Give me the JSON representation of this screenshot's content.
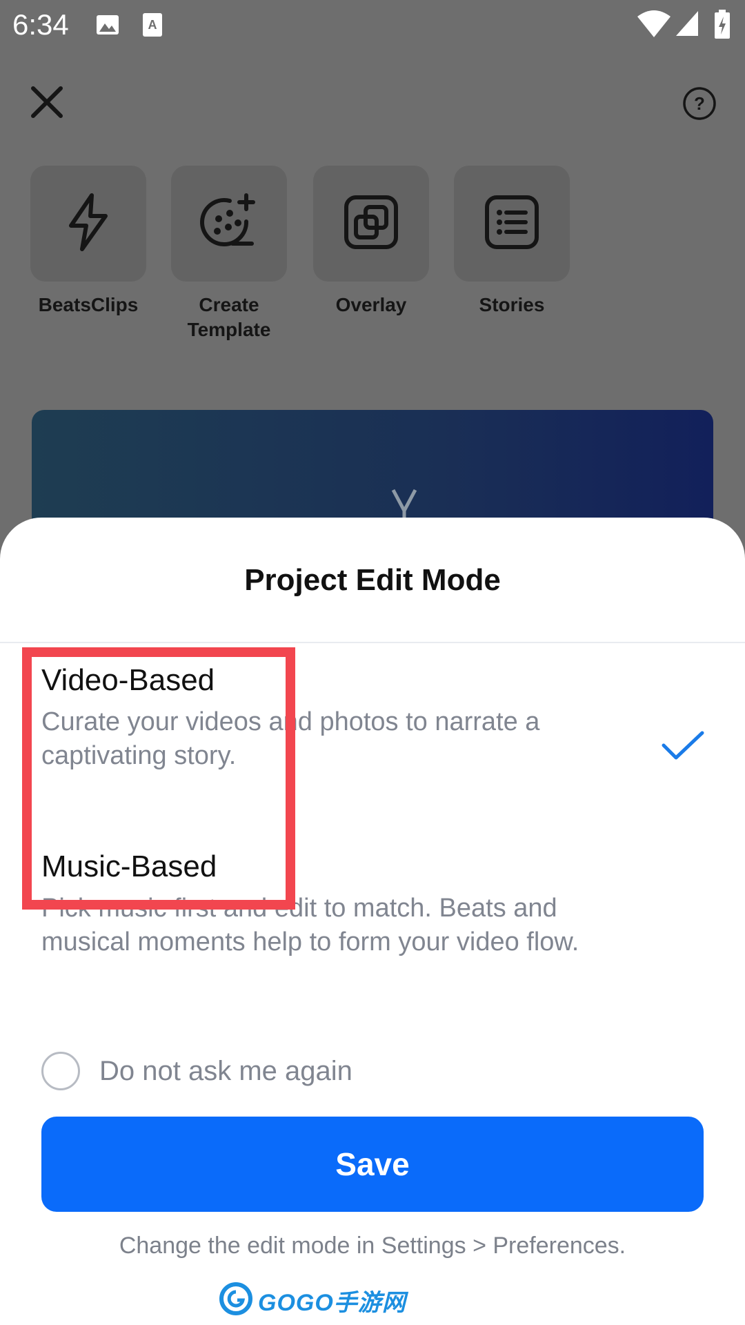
{
  "status_bar": {
    "time": "6:34"
  },
  "tools": [
    {
      "label": "BeatsClips",
      "icon": "lightning-icon"
    },
    {
      "label": "Create\nTemplate",
      "icon": "film-plus-icon"
    },
    {
      "label": "Overlay",
      "icon": "overlay-icon"
    },
    {
      "label": "Stories",
      "icon": "list-icon"
    }
  ],
  "sheet": {
    "title": "Project Edit Mode",
    "options": [
      {
        "title": "Video-Based",
        "description": "Curate your videos and photos to narrate a captivating story.",
        "selected": true
      },
      {
        "title": "Music-Based",
        "description": "Pick music first and edit to match. Beats and musical moments help to form your video flow.",
        "selected": false
      }
    ],
    "dont_ask_label": "Do not ask me again",
    "dont_ask_checked": false,
    "save_label": "Save",
    "footnote": "Change the edit mode in Settings > Preferences."
  },
  "watermark": {
    "text": "GOGO手游网"
  },
  "colors": {
    "accent": "#0a6bfa",
    "highlight": "#f2464f",
    "check": "#1a7be8"
  }
}
